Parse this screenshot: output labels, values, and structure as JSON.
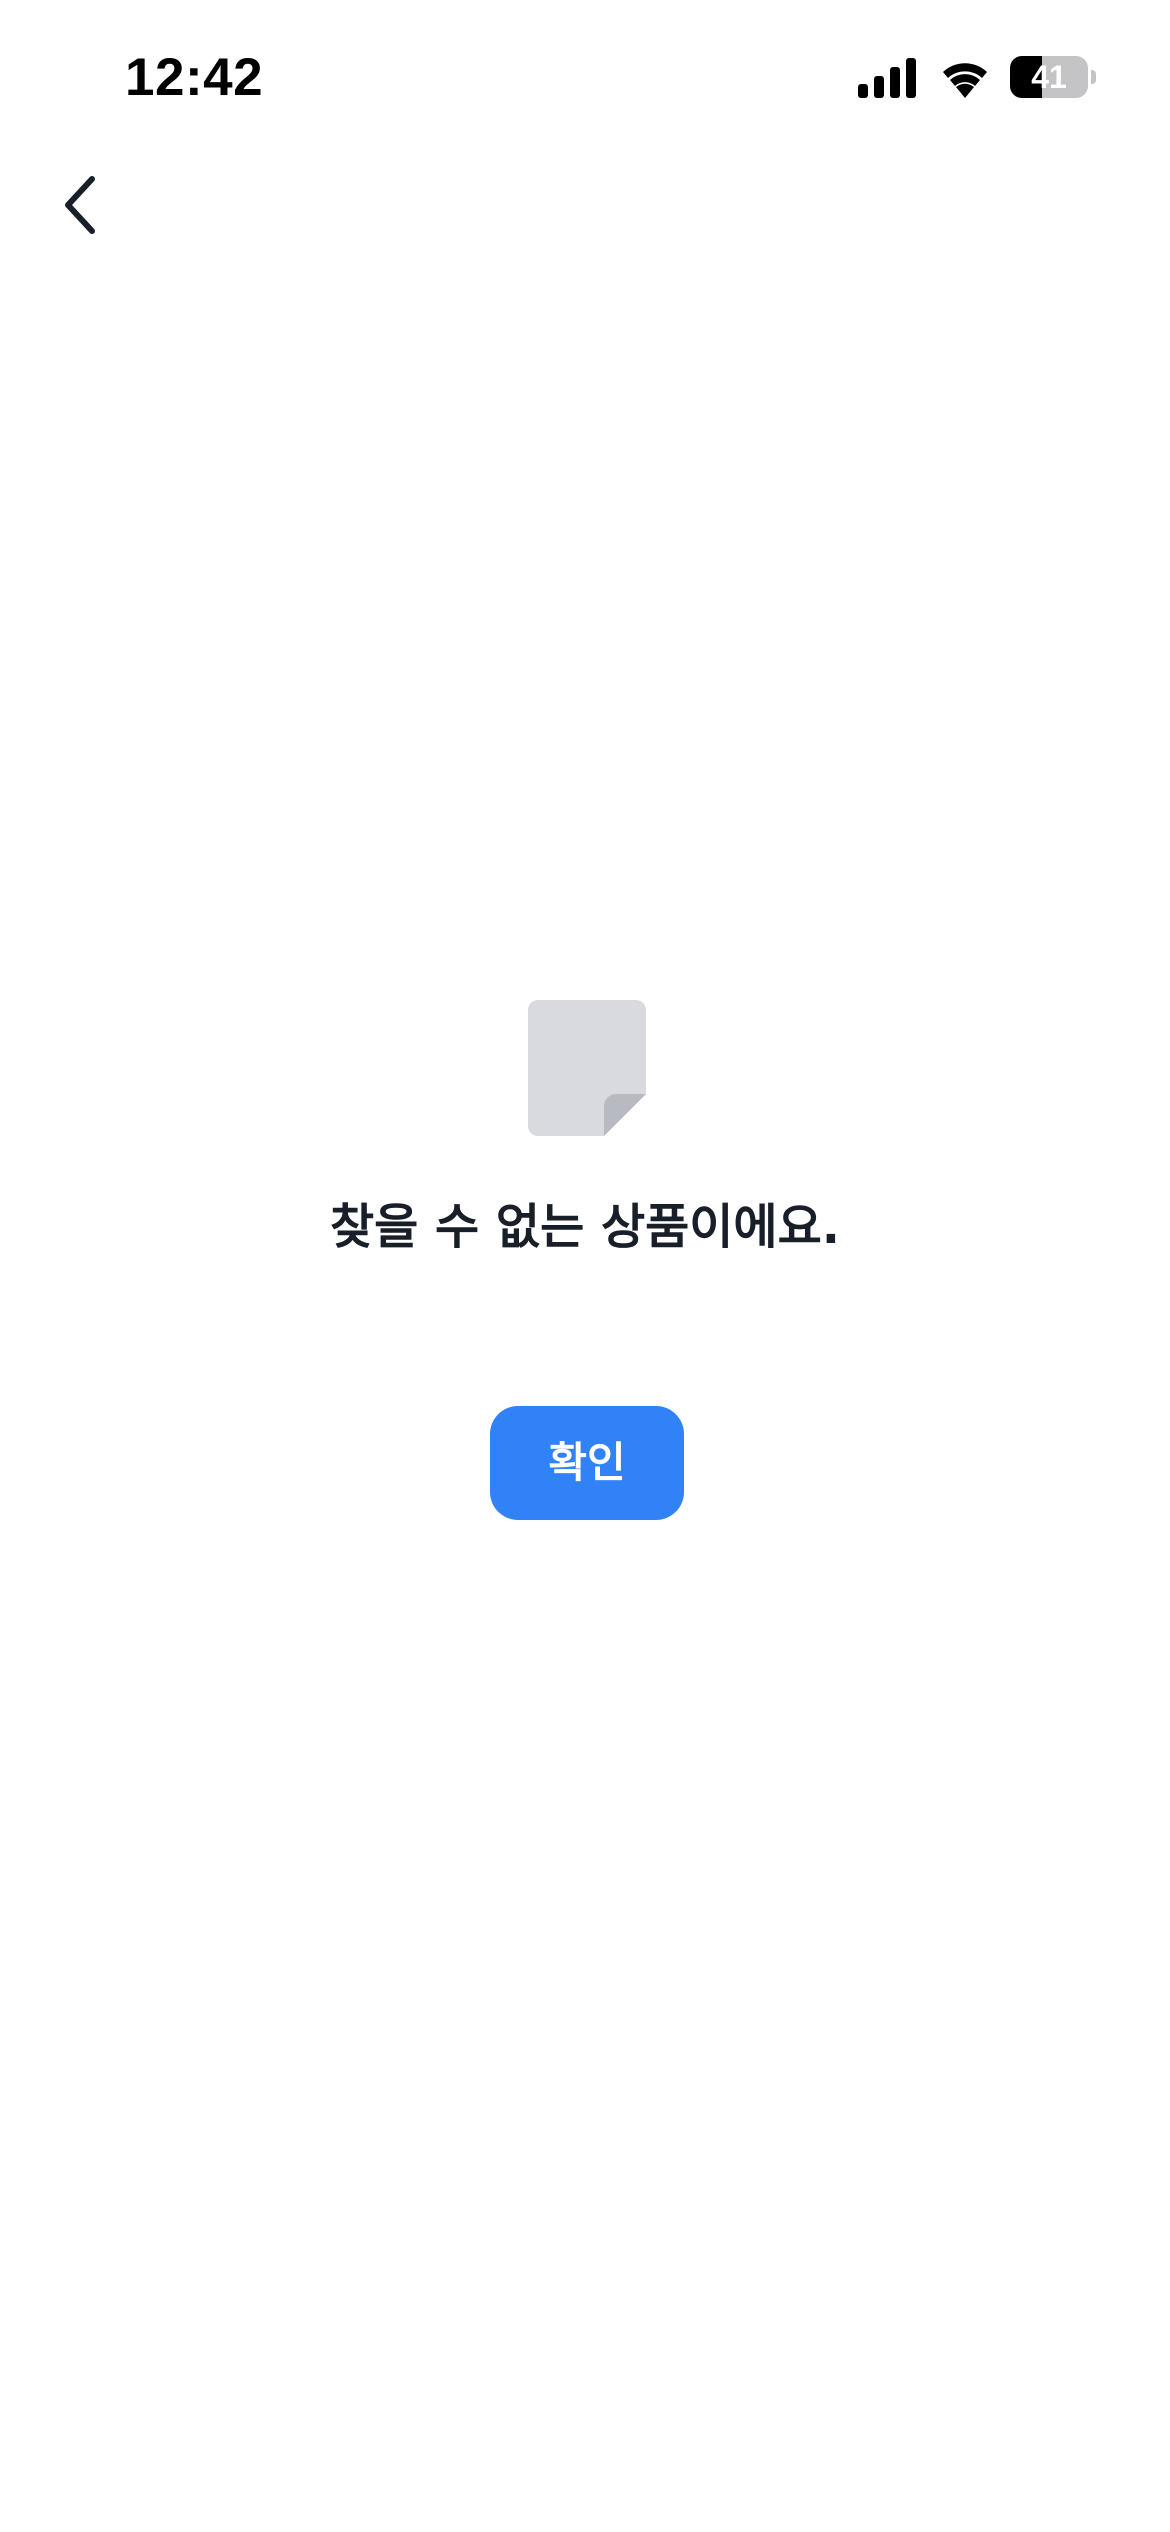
{
  "status_bar": {
    "time": "12:42",
    "battery_level": "41",
    "battery_fraction": 0.41
  },
  "nav": {
    "back_icon": "chevron-left-icon"
  },
  "empty_state": {
    "icon": "document-icon",
    "message": "찾을 수 없는 상품이에요.",
    "confirm_label": "확인"
  },
  "colors": {
    "accent": "#3182f6",
    "text_primary": "#191f28",
    "icon_gray": "#d9dadf",
    "icon_fold": "#b8bac1",
    "background": "#ffffff"
  }
}
